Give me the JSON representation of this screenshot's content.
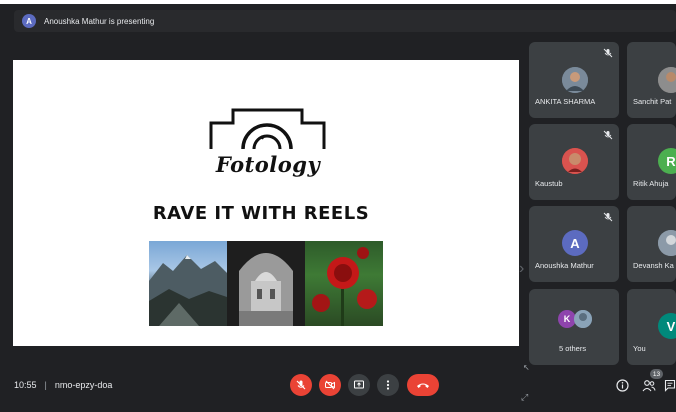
{
  "presentation": {
    "presenter_initial": "A",
    "banner": "Anoushka Mathur is presenting"
  },
  "slide": {
    "logo_text": "Fotology",
    "headline": "RAVE IT WITH REELS"
  },
  "participants": [
    {
      "name": "ANKITA SHARMA",
      "muted": true,
      "avatar": "photo"
    },
    {
      "name": "Sanchit Pat",
      "muted": false,
      "avatar": "photo"
    },
    {
      "name": "Kaustub",
      "muted": true,
      "avatar": "photo"
    },
    {
      "name": "Ritik Ahuja",
      "muted": false,
      "avatar": "letter",
      "initial": "R",
      "color": "#4caf50"
    },
    {
      "name": "Anoushka Mathur",
      "muted": true,
      "avatar": "letter",
      "initial": "A",
      "color": "#5c6bc0"
    },
    {
      "name": "Devansh Ka",
      "muted": false,
      "avatar": "photo"
    },
    {
      "name": "5 others",
      "muted": false,
      "avatar": "group",
      "initial": "K",
      "color": "#8e44ad"
    },
    {
      "name": "You",
      "muted": false,
      "avatar": "letter",
      "initial": "V",
      "color": "#00897b"
    }
  ],
  "meeting": {
    "time": "10:55",
    "code": "nmo-epzy-doa"
  },
  "people_count": "13",
  "colors": {
    "background": "#202124",
    "tile": "#3c4043",
    "end_call": "#ea4335"
  }
}
